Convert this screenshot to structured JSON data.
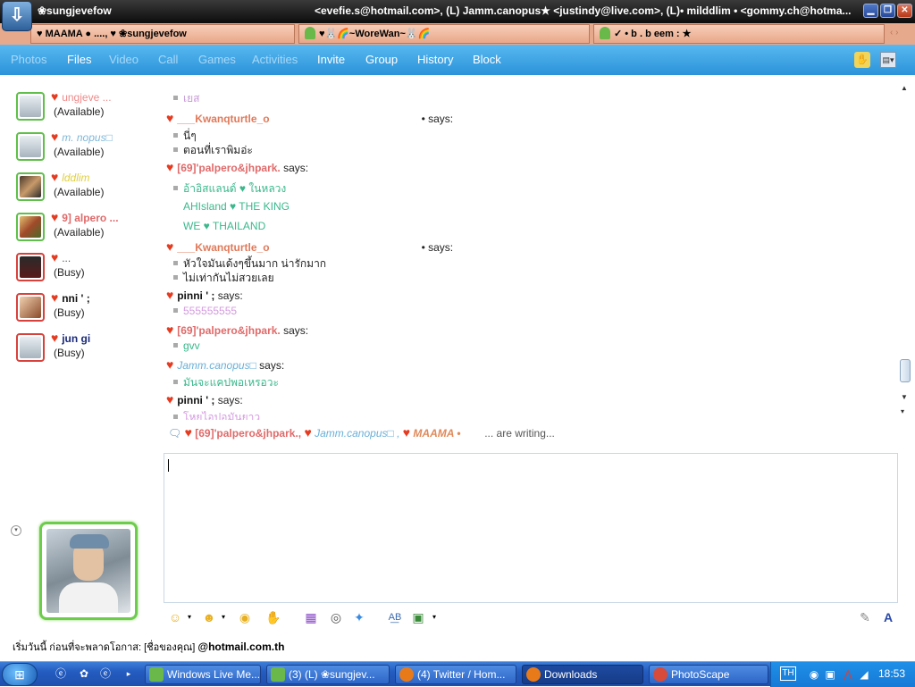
{
  "window": {
    "title_name": "❀sungjevefow",
    "title_participants": "<evefie.s@hotmail.com>, (L) Jamm.canopus★ <justindy@live.com>, (L)• milddlim • <gommy.ch@hotma...",
    "buttons": {
      "minimize": "▁",
      "restore": "❐",
      "close": "✕"
    }
  },
  "conversation_tabs": [
    {
      "label": "♥ MAAMA ● ...., ♥ ❀sungjevefow"
    },
    {
      "label": "♥🐰🌈~WoreWan~🐰🌈"
    },
    {
      "label": "✓  • b . b eem :    ★"
    }
  ],
  "nav": {
    "items": [
      {
        "label": "Photos",
        "enabled": false
      },
      {
        "label": "Files",
        "enabled": true
      },
      {
        "label": "Video",
        "enabled": false
      },
      {
        "label": "Call",
        "enabled": false
      },
      {
        "label": "Games",
        "enabled": false
      },
      {
        "label": "Activities",
        "enabled": false
      },
      {
        "label": "Invite",
        "enabled": true
      },
      {
        "label": "Group",
        "enabled": true
      },
      {
        "label": "History",
        "enabled": true
      },
      {
        "label": "Block",
        "enabled": true
      }
    ]
  },
  "contacts": [
    {
      "name": "ungjeve    ...",
      "status": "(Available)",
      "presence": "available",
      "name_color": "#f08a8a"
    },
    {
      "name": "m.  nopus□",
      "status": "(Available)",
      "presence": "available",
      "name_color": "#7fb8d8"
    },
    {
      "name": "lddlim",
      "status": "(Available)",
      "presence": "available",
      "name_color": "#e0d040"
    },
    {
      "name": "9]  alpero    ...",
      "status": "(Available)",
      "presence": "available",
      "name_color": "#e06a6a"
    },
    {
      "name": "                  ...",
      "status": "(Busy)",
      "presence": "busy",
      "name_color": "#555555"
    },
    {
      "name": "nni ' ;",
      "status": "(Busy)",
      "presence": "busy",
      "name_color": "#111111"
    },
    {
      "name": "jun  gi",
      "status": "(Busy)",
      "presence": "busy",
      "name_color": "#1a2a7a"
    }
  ],
  "messages": [
    {
      "kind": "text",
      "text": "เยส",
      "color": "#c79ad8"
    },
    {
      "kind": "sender",
      "name": "___Kwanqturtle_o",
      "suffix": "• says:",
      "color": "#e07a5a"
    },
    {
      "kind": "text",
      "text": "นี่ๆ",
      "color": "#222222"
    },
    {
      "kind": "text",
      "text": "ตอนที่เราพิมอ่ะ",
      "color": "#222222"
    },
    {
      "kind": "sender",
      "name": "[69]'palpero&jhpark.",
      "suffix": "says:",
      "color": "#e06a6a"
    },
    {
      "kind": "text",
      "text": "อ้าอิสแลนด์ ♥ ในหลวง",
      "color": "#3ab88c"
    },
    {
      "kind": "text",
      "text": "AHIsland ♥ THE KING",
      "color": "#3ab88c"
    },
    {
      "kind": "text",
      "text": "WE ♥ THAILAND",
      "color": "#3ab88c"
    },
    {
      "kind": "sender",
      "name": "___Kwanqturtle_o",
      "suffix": "• says:",
      "color": "#e07a5a"
    },
    {
      "kind": "text",
      "text": "หัวใจมันเด้งๆขึ้นมาก น่ารักมาก",
      "color": "#222222"
    },
    {
      "kind": "text",
      "text": "ไม่เท่ากันไม่สวยเลย",
      "color": "#222222"
    },
    {
      "kind": "sender",
      "name": "pinni ' ;",
      "suffix": "says:",
      "color": "#111111"
    },
    {
      "kind": "text",
      "text": "555555555",
      "color": "#d49ae0"
    },
    {
      "kind": "sender",
      "name": "[69]'palpero&jhpark.",
      "suffix": "says:",
      "color": "#e06a6a"
    },
    {
      "kind": "text",
      "text": "gvv",
      "color": "#3ab88c"
    },
    {
      "kind": "sender",
      "name": "Jamm.canopus□",
      "suffix": "says:",
      "color": "#6ab0d8"
    },
    {
      "kind": "text",
      "text": "มันจะแคปพอเหรอวะ",
      "color": "#3ab88c"
    },
    {
      "kind": "sender",
      "name": "pinni ' ;",
      "suffix": "says:",
      "color": "#111111"
    },
    {
      "kind": "text",
      "text": "โหยไอปอมันยาว",
      "color": "#d49ae0"
    }
  ],
  "writing": {
    "names": [
      "[69]'palpero&jhpark.,",
      "Jamm.canopus□ ,",
      "MAAMA •"
    ],
    "suffix": "... are writing..."
  },
  "footer": {
    "prefix": "เริ่มวันนี้  ก่อนที่จะพลาดโอกาส:  [ชื่อของคุณ]",
    "domain": "@hotmail.com.th"
  },
  "taskbar": {
    "tasks": [
      {
        "label": "Windows Live Me...",
        "active": false
      },
      {
        "label": "(3) (L) ❀sungjev...",
        "active": false
      },
      {
        "label": "(4) Twitter / Hom...",
        "active": false
      },
      {
        "label": "Downloads",
        "active": true
      },
      {
        "label": "PhotoScape",
        "active": false
      }
    ],
    "lang": "TH",
    "clock": "18:53"
  },
  "colors": {
    "nav_bg": "#2b93da",
    "tab_row": "#e7a98c",
    "available": "#5fbf4a",
    "busy": "#d8413b"
  }
}
